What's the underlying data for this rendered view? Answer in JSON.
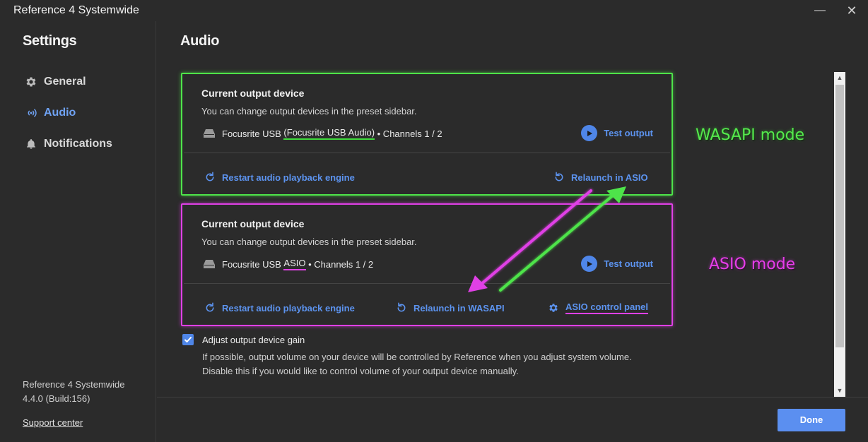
{
  "window": {
    "title": "Reference 4 Systemwide",
    "minimize_glyph": "—",
    "close_glyph": "✕"
  },
  "sidebar": {
    "heading": "Settings",
    "items": [
      {
        "label": "General",
        "icon": "gear-icon"
      },
      {
        "label": "Audio",
        "icon": "audio-waves-icon",
        "active": true
      },
      {
        "label": "Notifications",
        "icon": "bell-icon"
      }
    ],
    "app_name": "Reference 4 Systemwide",
    "version": "4.4.0 (Build:156)",
    "support_link": "Support center"
  },
  "main": {
    "title": "Audio",
    "wasapi_card": {
      "title": "Current output device",
      "subtitle": "You can change output devices in the preset sidebar.",
      "device_prefix": "Focusrite USB ",
      "device_highlight": "(Focusrite USB Audio)",
      "device_suffix": " • Channels 1 / 2",
      "test_output": "Test output",
      "restart_engine": "Restart audio playback engine",
      "relaunch": "Relaunch in ASIO"
    },
    "asio_card": {
      "title": "Current output device",
      "subtitle": "You can change output devices in the preset sidebar.",
      "device_prefix": "Focusrite USB ",
      "device_highlight": "ASIO",
      "device_suffix": " • Channels 1 / 2",
      "test_output": "Test output",
      "restart_engine": "Restart audio playback engine",
      "relaunch": "Relaunch in WASAPI",
      "control_panel": "ASIO control panel"
    },
    "gain_option": {
      "checked": true,
      "label": "Adjust output device gain",
      "desc_line1": "If possible, output volume on your device will be controlled by Reference when you adjust system volume.",
      "desc_line2": "Disable this if you would like to control volume of your output device manually."
    }
  },
  "annotations": {
    "wasapi": "WASAPI mode",
    "asio": "ASIO mode",
    "wasapi_color": "#55ea4d",
    "asio_color": "#e63ee9"
  },
  "footer": {
    "done": "Done"
  },
  "colors": {
    "accent": "#5c93ef",
    "background": "#2b2b2b",
    "button": "#5b8ff0"
  }
}
